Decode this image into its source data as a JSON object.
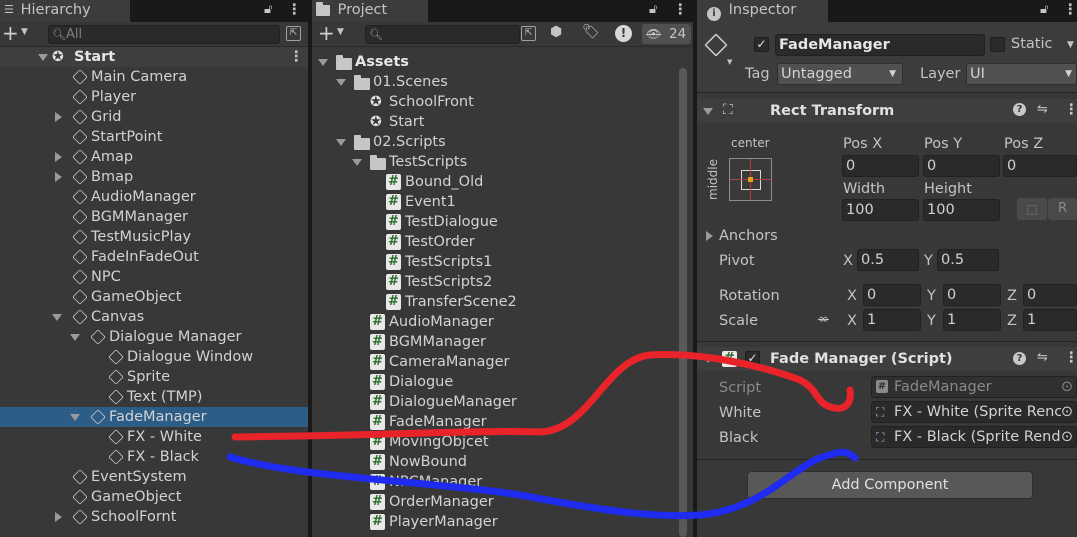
{
  "hierarchy": {
    "tab_label": "Hierarchy",
    "search_placeholder": "All",
    "scene": "Start",
    "items": [
      {
        "label": "Main Camera",
        "indent": 1,
        "arrow": "none"
      },
      {
        "label": "Player",
        "indent": 1,
        "arrow": "none"
      },
      {
        "label": "Grid",
        "indent": 1,
        "arrow": "right"
      },
      {
        "label": "StartPoint",
        "indent": 1,
        "arrow": "none"
      },
      {
        "label": "Amap",
        "indent": 1,
        "arrow": "right"
      },
      {
        "label": "Bmap",
        "indent": 1,
        "arrow": "right"
      },
      {
        "label": "AudioManager",
        "indent": 1,
        "arrow": "none"
      },
      {
        "label": "BGMManager",
        "indent": 1,
        "arrow": "none"
      },
      {
        "label": "TestMusicPlay",
        "indent": 1,
        "arrow": "none"
      },
      {
        "label": "FadeInFadeOut",
        "indent": 1,
        "arrow": "none"
      },
      {
        "label": "NPC",
        "indent": 1,
        "arrow": "none"
      },
      {
        "label": "GameObject",
        "indent": 1,
        "arrow": "none"
      },
      {
        "label": "Canvas",
        "indent": 1,
        "arrow": "down"
      },
      {
        "label": "Dialogue Manager",
        "indent": 2,
        "arrow": "down"
      },
      {
        "label": "Dialogue Window",
        "indent": 3,
        "arrow": "none"
      },
      {
        "label": "Sprite",
        "indent": 3,
        "arrow": "none"
      },
      {
        "label": "Text (TMP)",
        "indent": 3,
        "arrow": "none"
      },
      {
        "label": "FadeManager",
        "indent": 2,
        "arrow": "down",
        "selected": true
      },
      {
        "label": "FX - White",
        "indent": 3,
        "arrow": "none"
      },
      {
        "label": "FX - Black",
        "indent": 3,
        "arrow": "none"
      },
      {
        "label": "EventSystem",
        "indent": 1,
        "arrow": "none"
      },
      {
        "label": "GameObject",
        "indent": 1,
        "arrow": "none"
      },
      {
        "label": "SchoolFornt",
        "indent": 1,
        "arrow": "right"
      }
    ]
  },
  "project": {
    "tab_label": "Project",
    "hidden_count": "24",
    "items": [
      {
        "label": "Assets",
        "indent": 0,
        "arrow": "down",
        "icon": "folder",
        "bold": true
      },
      {
        "label": "01.Scenes",
        "indent": 1,
        "arrow": "down",
        "icon": "folder"
      },
      {
        "label": "SchoolFront",
        "indent": 2,
        "arrow": "none",
        "icon": "scene"
      },
      {
        "label": "Start",
        "indent": 2,
        "arrow": "none",
        "icon": "scene"
      },
      {
        "label": "02.Scripts",
        "indent": 1,
        "arrow": "down",
        "icon": "folder"
      },
      {
        "label": "TestScripts",
        "indent": 2,
        "arrow": "down",
        "icon": "folder"
      },
      {
        "label": "Bound_Old",
        "indent": 3,
        "arrow": "none",
        "icon": "script"
      },
      {
        "label": "Event1",
        "indent": 3,
        "arrow": "none",
        "icon": "script"
      },
      {
        "label": "TestDialogue",
        "indent": 3,
        "arrow": "none",
        "icon": "script"
      },
      {
        "label": "TestOrder",
        "indent": 3,
        "arrow": "none",
        "icon": "script"
      },
      {
        "label": "TestScripts1",
        "indent": 3,
        "arrow": "none",
        "icon": "script"
      },
      {
        "label": "TestScripts2",
        "indent": 3,
        "arrow": "none",
        "icon": "script"
      },
      {
        "label": "TransferScene2",
        "indent": 3,
        "arrow": "none",
        "icon": "script"
      },
      {
        "label": "AudioManager",
        "indent": 2,
        "arrow": "none",
        "icon": "script"
      },
      {
        "label": "BGMManager",
        "indent": 2,
        "arrow": "none",
        "icon": "script"
      },
      {
        "label": "CameraManager",
        "indent": 2,
        "arrow": "none",
        "icon": "script"
      },
      {
        "label": "Dialogue",
        "indent": 2,
        "arrow": "none",
        "icon": "script"
      },
      {
        "label": "DialogueManager",
        "indent": 2,
        "arrow": "none",
        "icon": "script"
      },
      {
        "label": "FadeManager",
        "indent": 2,
        "arrow": "none",
        "icon": "script"
      },
      {
        "label": "MovingObjcet",
        "indent": 2,
        "arrow": "none",
        "icon": "script"
      },
      {
        "label": "NowBound",
        "indent": 2,
        "arrow": "none",
        "icon": "script"
      },
      {
        "label": "NPCManager",
        "indent": 2,
        "arrow": "none",
        "icon": "script"
      },
      {
        "label": "OrderManager",
        "indent": 2,
        "arrow": "none",
        "icon": "script"
      },
      {
        "label": "PlayerManager",
        "indent": 2,
        "arrow": "none",
        "icon": "script"
      }
    ]
  },
  "inspector": {
    "tab_label": "Inspector",
    "object_name": "FadeManager",
    "static_label": "Static",
    "tag_label": "Tag",
    "tag_value": "Untagged",
    "layer_label": "Layer",
    "layer_value": "UI",
    "rect_transform": {
      "title": "Rect Transform",
      "anchor_h": "center",
      "anchor_v": "middle",
      "pos_x_label": "Pos X",
      "pos_x": "0",
      "pos_y_label": "Pos Y",
      "pos_y": "0",
      "pos_z_label": "Pos Z",
      "pos_z": "0",
      "width_label": "Width",
      "width": "100",
      "height_label": "Height",
      "height": "100",
      "r_button": "R",
      "anchors_label": "Anchors",
      "pivot_label": "Pivot",
      "pivot_x_label": "X",
      "pivot_x": "0.5",
      "pivot_y_label": "Y",
      "pivot_y": "0.5",
      "rotation_label": "Rotation",
      "rot_x": "0",
      "rot_y": "0",
      "rot_z": "0",
      "scale_label": "Scale",
      "scale_x": "1",
      "scale_y": "1",
      "scale_z": "1",
      "x_label": "X",
      "y_label": "Y",
      "z_label": "Z"
    },
    "script_component": {
      "title": "Fade Manager (Script)",
      "script_label": "Script",
      "script_value": "FadeManager",
      "white_label": "White",
      "white_value": "FX - White (Sprite Renc",
      "black_label": "Black",
      "black_value": "FX - Black (Sprite Rend"
    },
    "add_component": "Add Component"
  },
  "annotations": {
    "red_stroke_color": "#e8232a",
    "blue_stroke_color": "#1f2cf0"
  }
}
